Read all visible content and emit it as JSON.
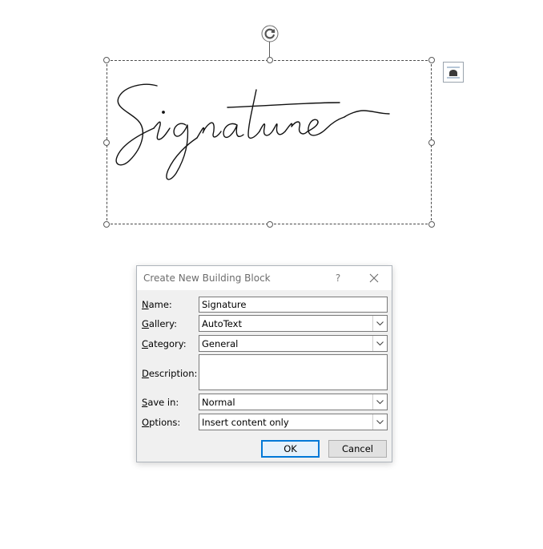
{
  "signature_image": {
    "text": "Signature"
  },
  "icons": {
    "rotate_handle": "rotate-handle-icon",
    "layout_options": "layout-options-icon",
    "close": "close-icon",
    "dropdown": "chevron-down-icon"
  },
  "dialog": {
    "title": "Create New Building Block",
    "help_label": "?",
    "fields": {
      "name": {
        "label": "Name:",
        "access_key": "N",
        "label_rest": "ame:",
        "value": "Signature"
      },
      "gallery": {
        "label": "Gallery:",
        "access_key": "G",
        "label_rest": "allery:",
        "value": "AutoText"
      },
      "category": {
        "label": "Category:",
        "access_key": "C",
        "label_rest": "ategory:",
        "value": "General"
      },
      "description": {
        "label": "Description:",
        "access_key": "D",
        "label_rest": "escription:",
        "value": ""
      },
      "save_in": {
        "label": "Save in:",
        "access_key": "S",
        "label_rest": "ave in:",
        "value": "Normal"
      },
      "options": {
        "label": "Options:",
        "access_key": "O",
        "label_rest": "ptions:",
        "value": "Insert content only"
      }
    },
    "ok_label": "OK",
    "cancel_label": "Cancel"
  },
  "colors": {
    "accent": "#0078d7",
    "dialog_bg": "#f0f0f0",
    "title_text": "#6d6d6d"
  }
}
